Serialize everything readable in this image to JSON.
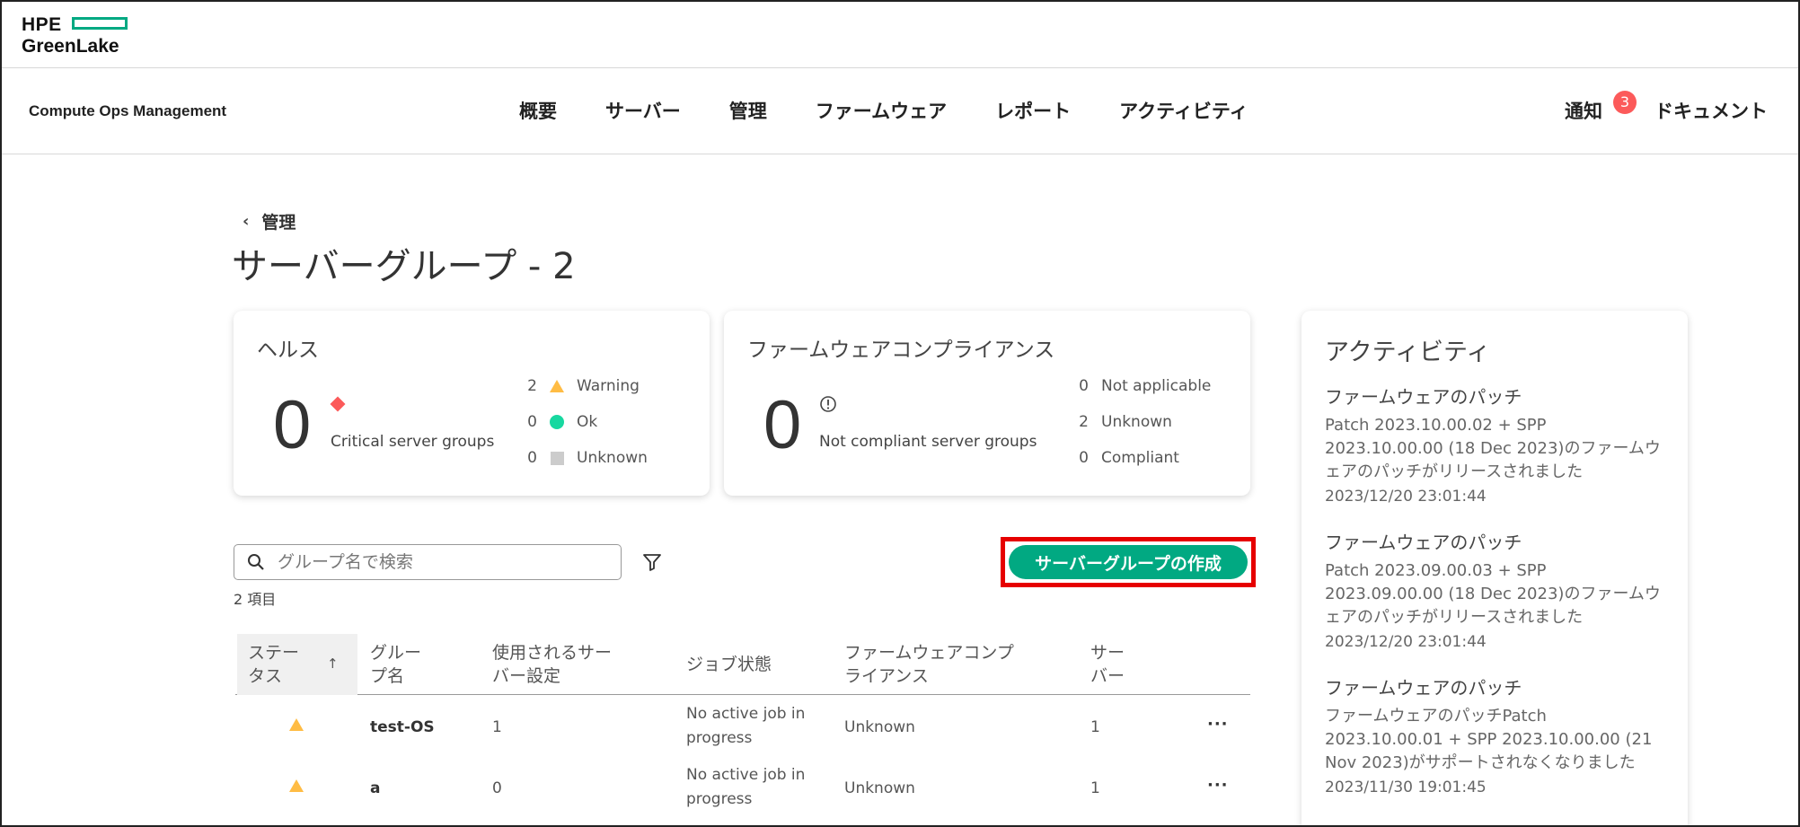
{
  "brand": {
    "line1": "HPE",
    "line2": "GreenLake",
    "accent": "#01a982"
  },
  "nav": {
    "app_name": "Compute Ops Management",
    "items": [
      "概要",
      "サーバー",
      "管理",
      "ファームウェア",
      "レポート",
      "アクティビティ"
    ],
    "notify_label": "通知",
    "notify_count": "3",
    "docs_label": "ドキュメント"
  },
  "breadcrumb": {
    "label": "管理"
  },
  "page": {
    "title": "サーバーグループ - 2"
  },
  "health": {
    "title": "ヘルス",
    "big": "0",
    "label": "Critical server groups",
    "legend": [
      {
        "count": "2",
        "label": "Warning",
        "icon": "warning-triangle-icon"
      },
      {
        "count": "0",
        "label": "Ok",
        "icon": "ok-dot-icon"
      },
      {
        "count": "0",
        "label": "Unknown",
        "icon": "unknown-square-icon"
      }
    ]
  },
  "compliance": {
    "title": "ファームウェアコンプライアンス",
    "big": "0",
    "label": "Not compliant server groups",
    "legend": [
      {
        "count": "0",
        "label": "Not applicable"
      },
      {
        "count": "2",
        "label": "Unknown"
      },
      {
        "count": "0",
        "label": "Compliant"
      }
    ]
  },
  "search": {
    "placeholder": "グループ名で検索"
  },
  "count_text": "2 項目",
  "create_button": "サーバーグループの作成",
  "table": {
    "headers": {
      "status": "ステー\nタス",
      "name": "グルー\nプ名",
      "settings": "使用されるサー\nバー設定",
      "job": "ジョブ状態",
      "firmware": "ファームウェアコンプ\nライアンス",
      "servers": "サー\nバー"
    },
    "rows": [
      {
        "name": "test-OS",
        "settings": "1",
        "job": "No active job in progress",
        "firmware": "Unknown",
        "servers": "1",
        "more": "···"
      },
      {
        "name": "a",
        "settings": "0",
        "job": "No active job in progress",
        "firmware": "Unknown",
        "servers": "1",
        "more": "···"
      }
    ]
  },
  "activity": {
    "title": "アクティビティ",
    "items": [
      {
        "heading": "ファームウェアのパッチ",
        "desc": "Patch 2023.10.00.02 + SPP 2023.10.00.00 (18 Dec 2023)のファームウェアのパッチがリリースされました",
        "time": "2023/12/20 23:01:44"
      },
      {
        "heading": "ファームウェアのパッチ",
        "desc": "Patch 2023.09.00.03 + SPP 2023.09.00.00 (18 Dec 2023)のファームウェアのパッチがリリースされました",
        "time": "2023/12/20 23:01:44"
      },
      {
        "heading": "ファームウェアのパッチ",
        "desc": "ファームウェアのパッチPatch 2023.10.00.01 + SPP 2023.10.00.00 (21 Nov 2023)がサポートされなくなりました",
        "time": "2023/11/30 19:01:45"
      }
    ]
  },
  "colors": {
    "accent": "#01a982",
    "critical": "#fc5a5a",
    "warning": "#ffbc44",
    "ok": "#17d8a0",
    "highlight": "#e60000"
  }
}
